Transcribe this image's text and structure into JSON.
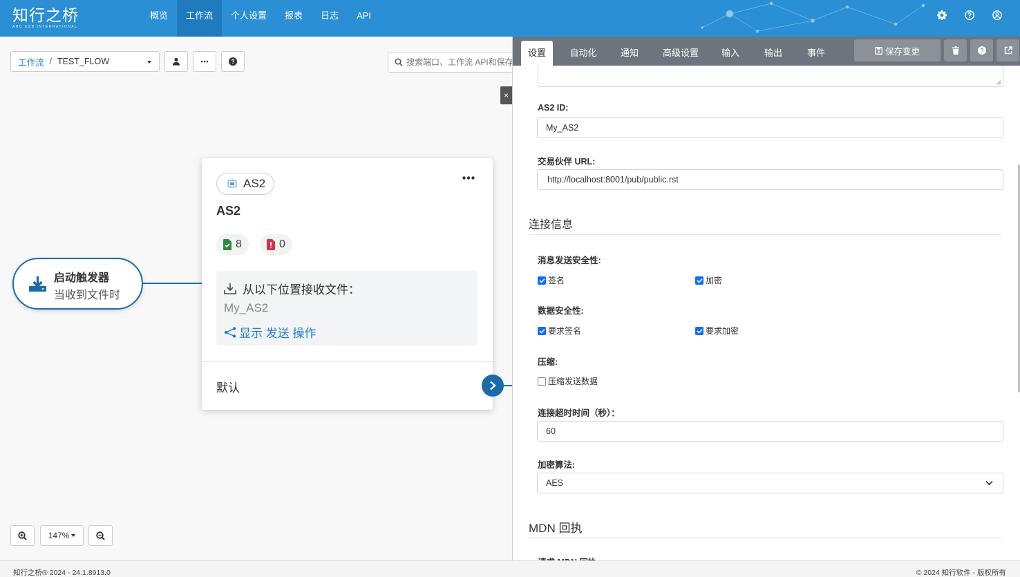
{
  "app": {
    "logo_text": "知行之桥",
    "logo_sub": "ARC ESB INTERNATIONAL"
  },
  "nav": {
    "items": [
      "概览",
      "工作流",
      "个人设置",
      "报表",
      "日志",
      "API"
    ],
    "active": "工作流"
  },
  "top_icons": [
    "gear-icon",
    "help-icon",
    "user-circle-icon"
  ],
  "toolbar": {
    "breadcrumb_link": "工作流",
    "breadcrumb_sep": "/",
    "breadcrumb_current": "TEST_FLOW",
    "search_placeholder": "搜索端口、工作流 API和保存"
  },
  "trigger": {
    "title": "启动触发器",
    "subtitle": "当收到文件时"
  },
  "node": {
    "chip_label": "AS2",
    "title": "AS2",
    "success_count": "8",
    "error_count": "0",
    "receive_label": "从以下位置接收文件：",
    "receive_value": "My_AS2",
    "show_send_link": "显示 发送 操作",
    "default_label": "默认"
  },
  "zoom": {
    "level": "147%"
  },
  "panel": {
    "tabs": [
      "设置",
      "自动化",
      "通知",
      "高级设置",
      "输入",
      "输出",
      "事件"
    ],
    "active_tab": "设置",
    "save_label": "保存变更",
    "as2_id_label": "AS2 ID:",
    "as2_id_value": "My_AS2",
    "partner_url_label": "交易伙伴 URL:",
    "partner_url_value": "http://localhost:8001/pub/public.rst",
    "conn_section": "连接信息",
    "msg_security_label": "消息发送安全性:",
    "msg_sign": "签名",
    "msg_encrypt": "加密",
    "data_security_label": "数据安全性:",
    "data_req_sign": "要求签名",
    "data_req_encrypt": "要求加密",
    "compression_label": "压缩:",
    "compress_send": "压缩发送数据",
    "timeout_label": "连接超时时间（秒）：",
    "timeout_value": "60",
    "enc_algo_label": "加密算法:",
    "enc_algo_value": "AES",
    "mdn_section": "MDN 回执",
    "mdn_request_label": "请求 MDN 回执:"
  },
  "footer": {
    "left": "知行之桥® 2024 - 24.1.8913.0",
    "right": "© 2024 知行软件 - 版权所有"
  },
  "colors": {
    "nav_bg": "#2a8fd4",
    "accent": "#1a6ca8",
    "link": "#1e7ec8",
    "tabbar": "#6c757d",
    "checkbox": "#0d6efd"
  }
}
